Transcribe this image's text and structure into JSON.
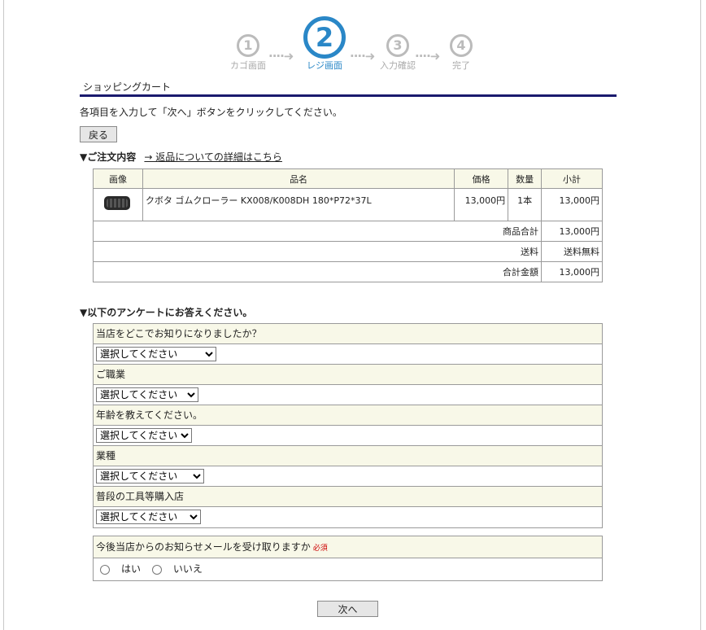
{
  "stepper": {
    "steps": [
      {
        "num": "1",
        "label": "カゴ画面"
      },
      {
        "num": "2",
        "label": "レジ画面"
      },
      {
        "num": "3",
        "label": "入力確認"
      },
      {
        "num": "4",
        "label": "完了"
      }
    ],
    "arrow": "····➜"
  },
  "page_title": "ショッピングカート",
  "instruction": "各項目を入力して「次へ」ボタンをクリックしてください。",
  "back_label": "戻る",
  "order_section": {
    "heading": "▼ご注文内容",
    "return_link": "→ 返品についての詳細はこちら"
  },
  "cart": {
    "headers": {
      "image": "画像",
      "name": "品名",
      "price": "価格",
      "qty": "数量",
      "subtotal": "小計"
    },
    "item": {
      "name": "クボタ ゴムクローラー KX008/K008DH 180*P72*37L",
      "price": "13,000円",
      "qty": "1本",
      "subtotal": "13,000円"
    },
    "product_total_label": "商品合計",
    "product_total": "13,000円",
    "shipping_label": "送料",
    "shipping": "送料無料",
    "grand_total_label": "合計金額",
    "grand_total": "13,000円"
  },
  "survey": {
    "heading": "▼以下のアンケートにお答えください。",
    "placeholder": "選択してください",
    "q1": "当店をどこでお知りになりましたか？",
    "q2": "ご職業",
    "q3": "年齢を教えてください。",
    "q4": "業種",
    "q5": "普段の工具等購入店"
  },
  "newsletter": {
    "question": "今後当店からのお知らせメールを受け取りますか",
    "required": "必須",
    "yes": "はい",
    "no": "いいえ"
  },
  "next_label": "次へ",
  "colors": {
    "accent": "#2a87c7",
    "title_rule": "#1a1a6e",
    "header_bg": "#f8f8e8",
    "required": "#cc0000"
  }
}
